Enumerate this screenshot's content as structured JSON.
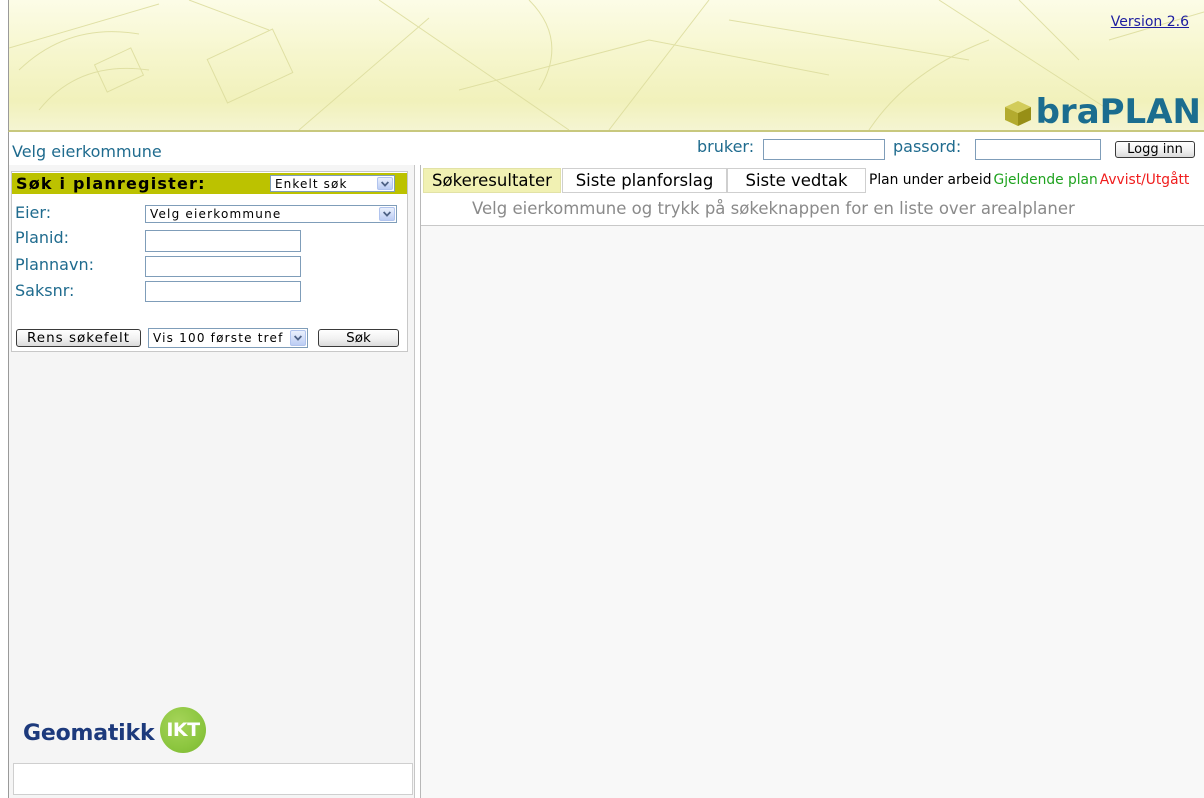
{
  "header": {
    "version_link": "Version 2.6",
    "logo_text": "braPLAN",
    "logo_icon": "cube-icon"
  },
  "topbar": {
    "owner_text": "Velg eierkommune",
    "user_label": "bruker:",
    "user_value": "",
    "password_label": "passord:",
    "password_value": "",
    "login_button": "Logg inn"
  },
  "search_panel": {
    "title": "Søk i planregister:",
    "mode_select": "Enkelt søk",
    "select_arrow_icon": "chevron-down-icon",
    "owner": {
      "label": "Eier:",
      "selected": "Velg eierkommune"
    },
    "plan_id": {
      "label": "Planid:",
      "value": ""
    },
    "plan_name": {
      "label": "Plannavn:",
      "value": ""
    },
    "case_number": {
      "label": "Saksnr:",
      "value": ""
    },
    "clear_button": "Rens søkefelt",
    "result_limit_select": "Vis 100 første tref",
    "search_button": "Søk"
  },
  "left_footer": {
    "logo_word": "Geomatikk",
    "logo_badge": "IKT"
  },
  "results": {
    "tabs": [
      {
        "label": "Søkeresultater",
        "active": true
      },
      {
        "label": "Siste planforslag",
        "active": false
      },
      {
        "label": "Siste vedtak",
        "active": false
      }
    ],
    "legend": [
      {
        "label": "Plan under arbeid",
        "color": "#000000"
      },
      {
        "label": "Gjeldende plan",
        "color": "#1fa31f"
      },
      {
        "label": "Avvist/Utgått",
        "color": "#f01c1c"
      }
    ],
    "message": "Velg eierkommune og trykk på søkeknappen for en liste over arealplaner"
  },
  "colors": {
    "brand": "#1b6d8f",
    "label_text": "#1f6b8e",
    "version_link": "#1d1da0",
    "search_header_bg": "#bcc200",
    "active_tab_bg": "#f1f1b3",
    "hint_text": "#8a8a8a",
    "logo_blue": "#1d3a7c",
    "logo_green": "#8cc63f"
  }
}
